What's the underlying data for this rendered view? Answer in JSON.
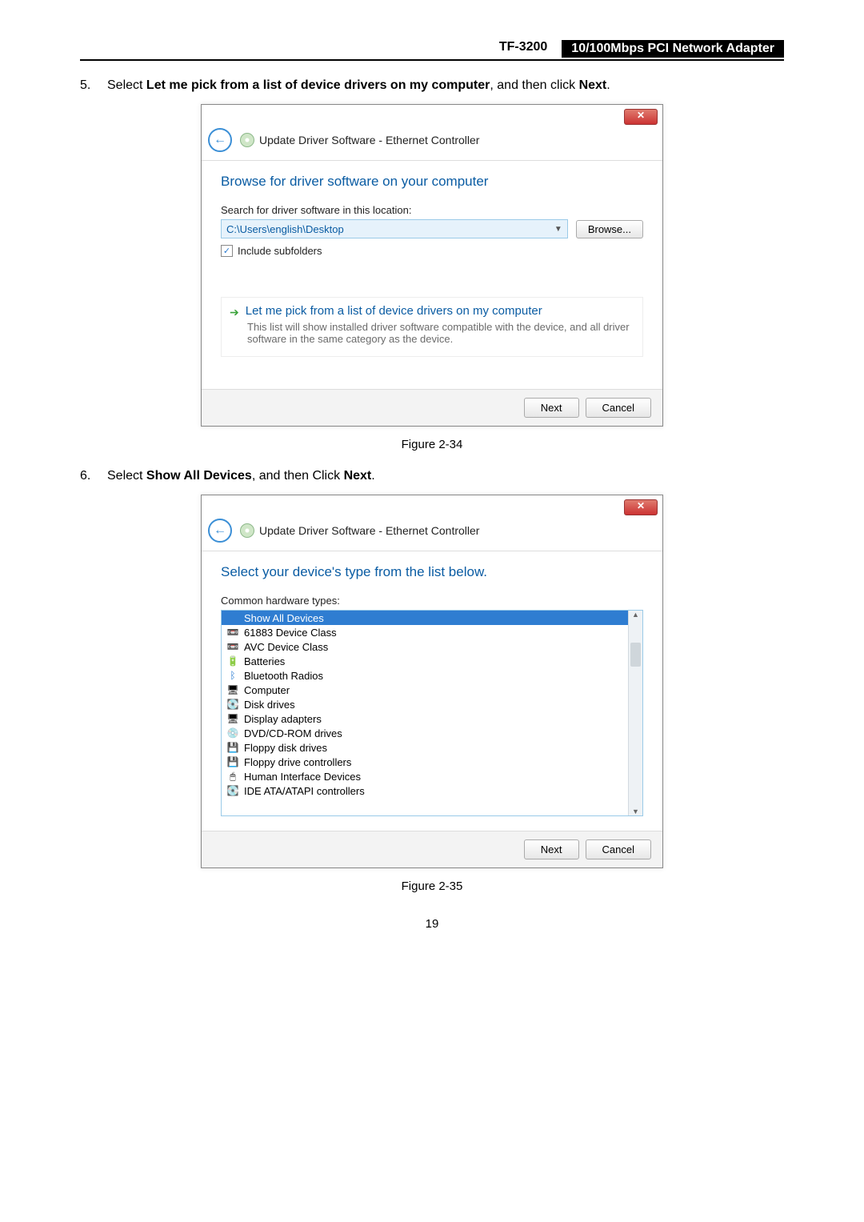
{
  "header": {
    "model": "TF-3200",
    "title": "10/100Mbps PCI Network Adapter"
  },
  "step5": {
    "num": "5.",
    "text_prefix": "Select ",
    "text_bold1": "Let me pick from a list of device drivers on my computer",
    "text_mid": ", and then click ",
    "text_bold2": "Next",
    "text_suffix": "."
  },
  "dialog1": {
    "breadcrumb": "Update Driver Software - Ethernet Controller",
    "title": "Browse for driver software on your computer",
    "search_label": "Search for driver software in this location:",
    "path": "C:\\Users\\english\\Desktop",
    "browse": "Browse...",
    "include": "Include subfolders",
    "opt_title": "Let me pick from a list of device drivers on my computer",
    "opt_desc": "This list will show installed driver software compatible with the device, and all driver software in the same category as the device.",
    "next": "Next",
    "cancel": "Cancel"
  },
  "caption1": "Figure 2-34",
  "step6": {
    "num": "6.",
    "text_prefix": "Select ",
    "text_bold1": "Show All Devices",
    "text_mid": ", and then Click ",
    "text_bold2": "Next",
    "text_suffix": "."
  },
  "dialog2": {
    "breadcrumb": "Update Driver Software - Ethernet Controller",
    "title": "Select your device's type from the list below.",
    "sub_label": "Common hardware types:",
    "items": [
      "Show All Devices",
      "61883 Device Class",
      "AVC Device Class",
      "Batteries",
      "Bluetooth Radios",
      "Computer",
      "Disk drives",
      "Display adapters",
      "DVD/CD-ROM drives",
      "Floppy disk drives",
      "Floppy drive controllers",
      "Human Interface Devices",
      "IDE ATA/ATAPI controllers"
    ],
    "next": "Next",
    "cancel": "Cancel"
  },
  "caption2": "Figure 2-35",
  "pagenum": "19"
}
